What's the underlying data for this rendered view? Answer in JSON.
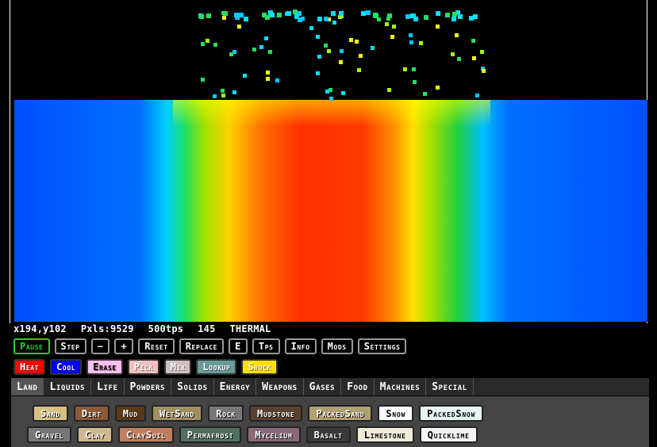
{
  "status": {
    "coords": "x194,y102",
    "pixels": "Pxls:9529",
    "tps": "500tps",
    "count": "145",
    "view": "THERMAL"
  },
  "controls": [
    {
      "label": "Pause",
      "name": "pause-button",
      "style": "pause"
    },
    {
      "label": "Step",
      "name": "step-button"
    },
    {
      "label": "−",
      "name": "decrease-size-button"
    },
    {
      "label": "+",
      "name": "increase-size-button"
    },
    {
      "label": "Reset",
      "name": "reset-button"
    },
    {
      "label": "Replace",
      "name": "replace-button"
    },
    {
      "label": "E",
      "name": "e-button"
    },
    {
      "label": "Tps",
      "name": "tps-button"
    },
    {
      "label": "Info",
      "name": "info-button"
    },
    {
      "label": "Mods",
      "name": "mods-button"
    },
    {
      "label": "Settings",
      "name": "settings-button"
    }
  ],
  "tools": [
    {
      "label": "Heat",
      "name": "heat-tool",
      "bg": "#ff0000",
      "fg": "#ffffff"
    },
    {
      "label": "Cool",
      "name": "cool-tool",
      "bg": "#0000ff",
      "fg": "#ffffff"
    },
    {
      "label": "Erase",
      "name": "erase-tool",
      "bg": "#ffc0f0",
      "fg": "#000000"
    },
    {
      "label": "Pick",
      "name": "pick-tool",
      "bg": "#f0c0c0",
      "fg": "#ffffff"
    },
    {
      "label": "Mix",
      "name": "mix-tool",
      "bg": "#d0c0c0",
      "fg": "#ffffff"
    },
    {
      "label": "Lookup",
      "name": "lookup-tool",
      "bg": "#6a9a9a",
      "fg": "#ffffff"
    },
    {
      "label": "Shock",
      "name": "shock-tool",
      "bg": "#ffe000",
      "fg": "#ffffff"
    }
  ],
  "categories": [
    {
      "label": "Land",
      "active": true
    },
    {
      "label": "Liquids"
    },
    {
      "label": "Life"
    },
    {
      "label": "Powders"
    },
    {
      "label": "Solids"
    },
    {
      "label": "Energy"
    },
    {
      "label": "Weapons"
    },
    {
      "label": "Gases"
    },
    {
      "label": "Food"
    },
    {
      "label": "Machines"
    },
    {
      "label": "Special"
    }
  ],
  "elements_row1": [
    {
      "label": "Sand",
      "bg": "#d8c080"
    },
    {
      "label": "Dirt",
      "bg": "#8a5a3a"
    },
    {
      "label": "Mud",
      "bg": "#5a3a1a"
    },
    {
      "label": "WetSand",
      "bg": "#a09060"
    },
    {
      "label": "Rock",
      "bg": "#777777"
    },
    {
      "label": "Mudstone",
      "bg": "#5a4030"
    },
    {
      "label": "PackedSand",
      "bg": "#b0a070"
    },
    {
      "label": "Snow",
      "bg": "#ffffff",
      "fg": "#000000"
    },
    {
      "label": "PackedSnow",
      "bg": "#e8f4f4",
      "fg": "#000000"
    }
  ],
  "elements_row2": [
    {
      "label": "Gravel",
      "bg": "#777777"
    },
    {
      "label": "Clay",
      "bg": "#d0b890"
    },
    {
      "label": "ClaySoil",
      "bg": "#c08060"
    },
    {
      "label": "Permafrost",
      "bg": "#507060"
    },
    {
      "label": "Mycelium",
      "bg": "#8a6a7a"
    },
    {
      "label": "Basalt",
      "bg": "#3a3a3a"
    },
    {
      "label": "Limestone",
      "bg": "#f0ecd8",
      "fg": "#000000"
    },
    {
      "label": "Quicklime",
      "bg": "#f4f4f4",
      "fg": "#000000"
    }
  ]
}
